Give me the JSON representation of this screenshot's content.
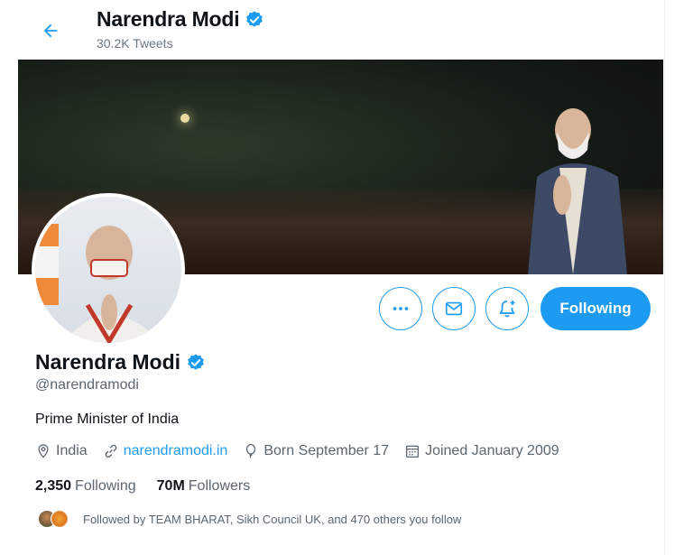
{
  "header": {
    "name": "Narendra Modi",
    "tweet_count": "30.2K Tweets",
    "back_icon": "back-arrow-icon"
  },
  "profile": {
    "name": "Narendra Modi",
    "handle": "@narendramodi",
    "bio": "Prime Minister of India",
    "verified_color": "#1d9bf0"
  },
  "meta": {
    "location": "India",
    "website": "narendramodi.in",
    "birthday": "Born September 17",
    "joined": "Joined January 2009"
  },
  "stats": {
    "following_count": "2,350",
    "following_label": "Following",
    "followers_count": "70M",
    "followers_label": "Followers"
  },
  "followed_by": {
    "text": "Followed by TEAM BHARAT, Sikh Council UK, and 470 others you follow"
  },
  "actions": {
    "more_icon": "more-icon",
    "message_icon": "mail-icon",
    "notify_icon": "bell-plus-icon",
    "follow_label": "Following"
  },
  "colors": {
    "accent": "#1d9bf0",
    "text_primary": "#0f1419",
    "text_secondary": "#5b6670"
  }
}
